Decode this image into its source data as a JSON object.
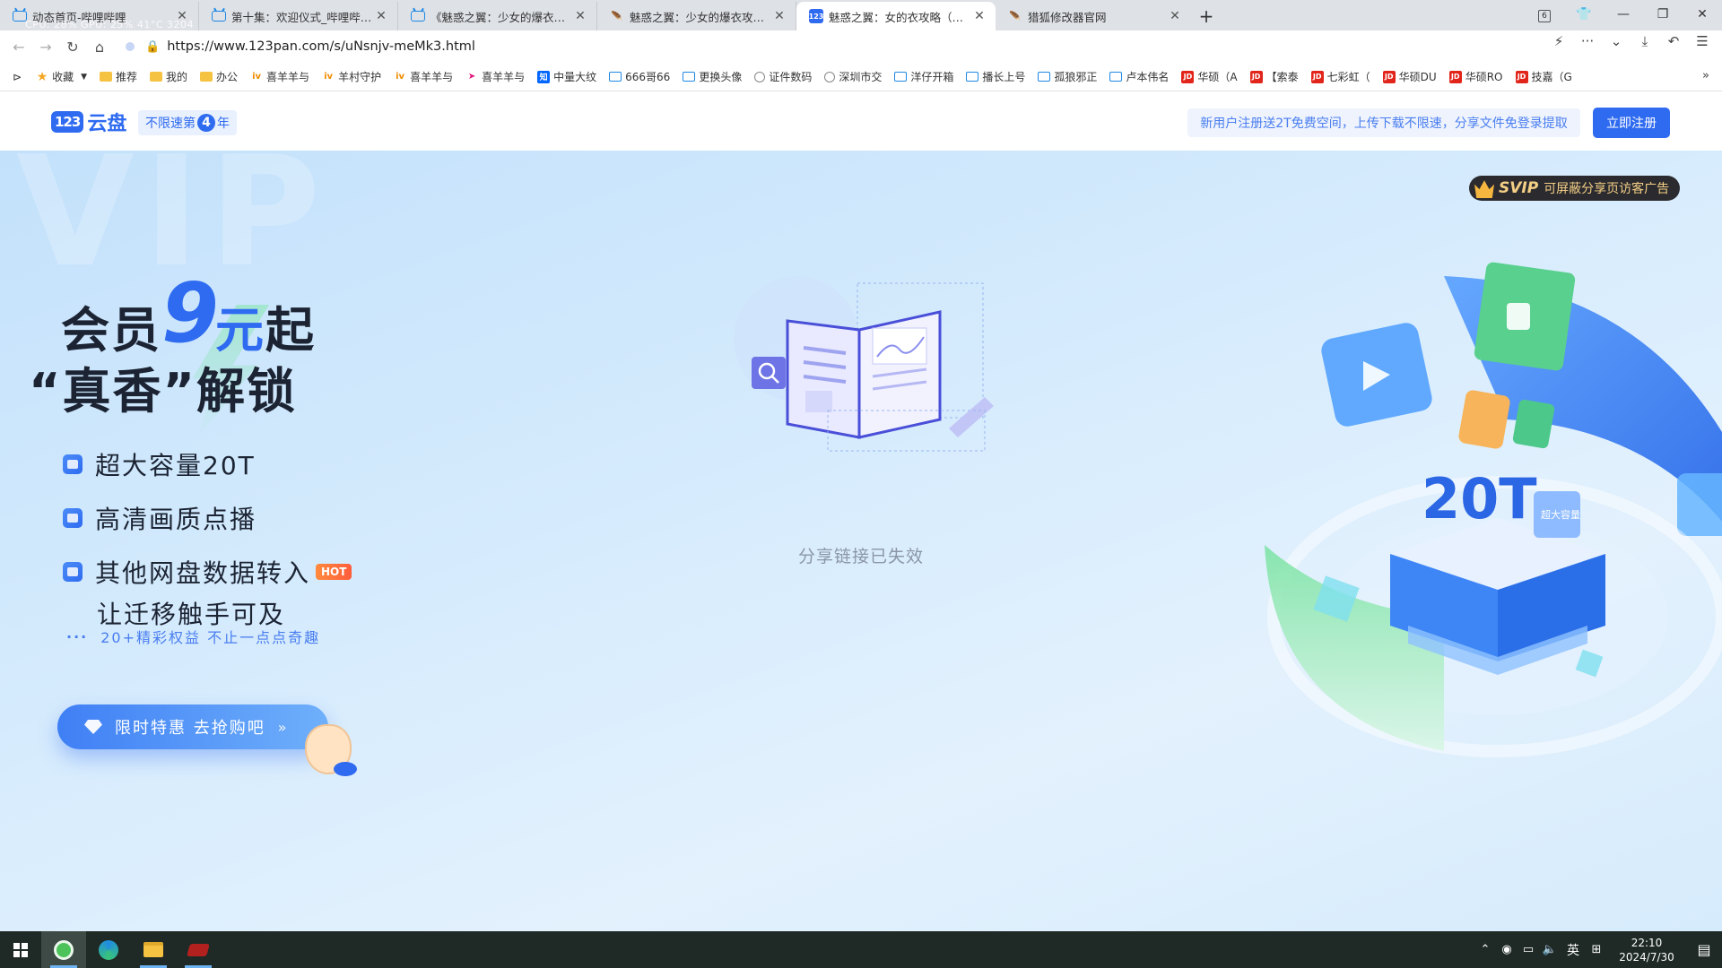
{
  "browser": {
    "tabs": [
      {
        "title": "动态首页-哔哩哔哩",
        "favicon": "bilibili-tv-icon",
        "active": false
      },
      {
        "title": "第十集：欢迎仪式_哔哩哔哩_b",
        "favicon": "bilibili-tv-icon",
        "active": false
      },
      {
        "title": "《魅惑之翼：少女的爆衣攻略》",
        "favicon": "bilibili-tv-icon",
        "active": false
      },
      {
        "title": "魅惑之翼：少女的爆衣攻略 统",
        "favicon": "bird-icon",
        "active": false
      },
      {
        "title": "魅惑之翼：女的衣攻略（自动",
        "favicon": "123pan-icon",
        "active": true
      },
      {
        "title": "猎狐修改器官网",
        "favicon": "bird-icon",
        "active": false
      }
    ],
    "overlay_text": "CPU: 28% GPU: 25% 41°C 3204",
    "window_badge": "6",
    "url": "https://www.123pan.com/s/uNsnjv-meMk3.html",
    "bookmarks": [
      {
        "label": "收藏",
        "icon": "star-icon"
      },
      {
        "label": "推荐",
        "icon": "folder-icon"
      },
      {
        "label": "我的",
        "icon": "folder-icon"
      },
      {
        "label": "办公",
        "icon": "folder-icon"
      },
      {
        "label": "喜羊羊与",
        "icon": "iqiyi-icon"
      },
      {
        "label": "羊村守护",
        "icon": "iqiyi-icon"
      },
      {
        "label": "喜羊羊与",
        "icon": "iqiyi-icon"
      },
      {
        "label": "喜羊羊与",
        "icon": "arrow-icon"
      },
      {
        "label": "中量大纹",
        "icon": "zhihu-icon"
      },
      {
        "label": "666哥66",
        "icon": "bilibili-tv-icon"
      },
      {
        "label": "更换头像",
        "icon": "bilibili-tv-icon"
      },
      {
        "label": "证件数码",
        "icon": "globe-icon"
      },
      {
        "label": "深圳市交",
        "icon": "globe-icon"
      },
      {
        "label": "洋仔开箱",
        "icon": "bilibili-tv-icon"
      },
      {
        "label": "播长上号",
        "icon": "bilibili-tv-icon"
      },
      {
        "label": "孤狼邪正",
        "icon": "bilibili-tv-icon"
      },
      {
        "label": "卢本伟名",
        "icon": "bilibili-tv-icon"
      },
      {
        "label": "华硕（A",
        "icon": "jd-icon"
      },
      {
        "label": "【索泰",
        "icon": "jd-icon"
      },
      {
        "label": "七彩虹（",
        "icon": "jd-icon"
      },
      {
        "label": "华硕DU",
        "icon": "jd-icon"
      },
      {
        "label": "华硕RO",
        "icon": "jd-icon"
      },
      {
        "label": "技嘉（G",
        "icon": "jd-icon"
      }
    ]
  },
  "site": {
    "logo_badge": "123",
    "logo_word": "云盘",
    "slogan_prefix": "不限速第",
    "slogan_num": "4",
    "slogan_suffix": "年",
    "notice": "新用户注册送2T免费空间，上传下载不限速，分享文件免登录提取",
    "register_label": "立即注册"
  },
  "hero": {
    "watermark": "VIP",
    "svip_word": "SVIP",
    "svip_text": "可屏蔽分享页访客广告",
    "title_line1_a": "会员",
    "title_big": "9",
    "title_line1_b": "元",
    "title_line1_c": "起",
    "title_line2": "“真香”解锁",
    "features": [
      {
        "text": "超大容量20T",
        "icon": "storage-icon"
      },
      {
        "text": "高清画质点播",
        "icon": "video-icon"
      },
      {
        "text": "其他网盘数据转入",
        "icon": "transfer-icon",
        "badge": "HOT",
        "sub": "让迁移触手可及"
      }
    ],
    "more_text": "20+精彩权益  不止一点点奇趣",
    "buy_label": "限时特惠  去抢购吧",
    "expired_text": "分享链接已失效",
    "illus_big_text": "20T",
    "illus_tag_text": "超大容量"
  },
  "taskbar": {
    "ime": "英",
    "time": "22:10",
    "date": "2024/7/30"
  },
  "colors": {
    "brand": "#2f6bf1",
    "hero_bg": "#d7ecfd",
    "taskbar": "#1f2a26"
  }
}
